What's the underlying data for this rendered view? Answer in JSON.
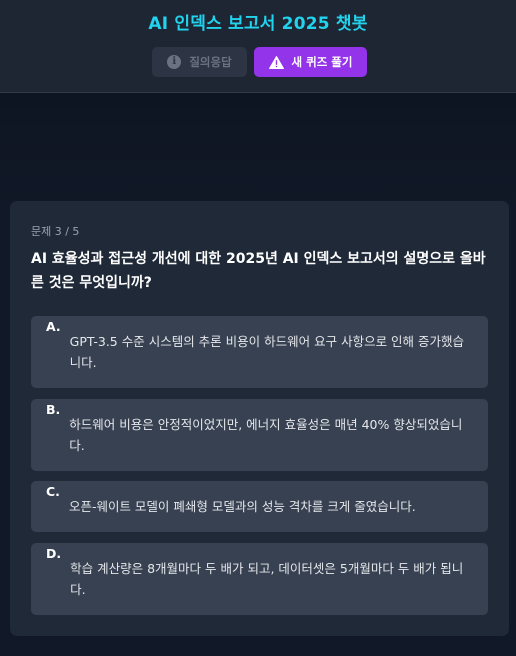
{
  "header": {
    "title": "AI 인덱스 보고서 2025 챗봇",
    "qa_button": {
      "label": "질의응답",
      "icon": "info-circle-icon"
    },
    "quiz_button": {
      "label": "새 퀴즈 풀기",
      "icon": "warning-triangle-icon"
    }
  },
  "colors": {
    "title": "#22d3ee",
    "quiz_button": "#9333ea",
    "card": "#1f2937",
    "option": "#374151",
    "background": "#111827"
  },
  "quiz": {
    "counter": "문제 3 / 5",
    "question": "AI 효율성과 접근성 개선에 대한 2025년 AI 인덱스 보고서의 설명으로 올바른 것은 무엇입니까?",
    "options": [
      {
        "letter": "A.",
        "text": "GPT-3.5 수준 시스템의 추론 비용이 하드웨어 요구 사항으로 인해 증가했습니다."
      },
      {
        "letter": "B.",
        "text": "하드웨어 비용은 안정적이었지만, 에너지 효율성은 매년 40% 향상되었습니다."
      },
      {
        "letter": "C.",
        "text": "오픈-웨이트 모델이 폐쇄형 모델과의 성능 격차를 크게 줄였습니다."
      },
      {
        "letter": "D.",
        "text": "학습 계산량은 8개월마다 두 배가 되고, 데이터셋은 5개월마다 두 배가 됩니다."
      }
    ]
  }
}
